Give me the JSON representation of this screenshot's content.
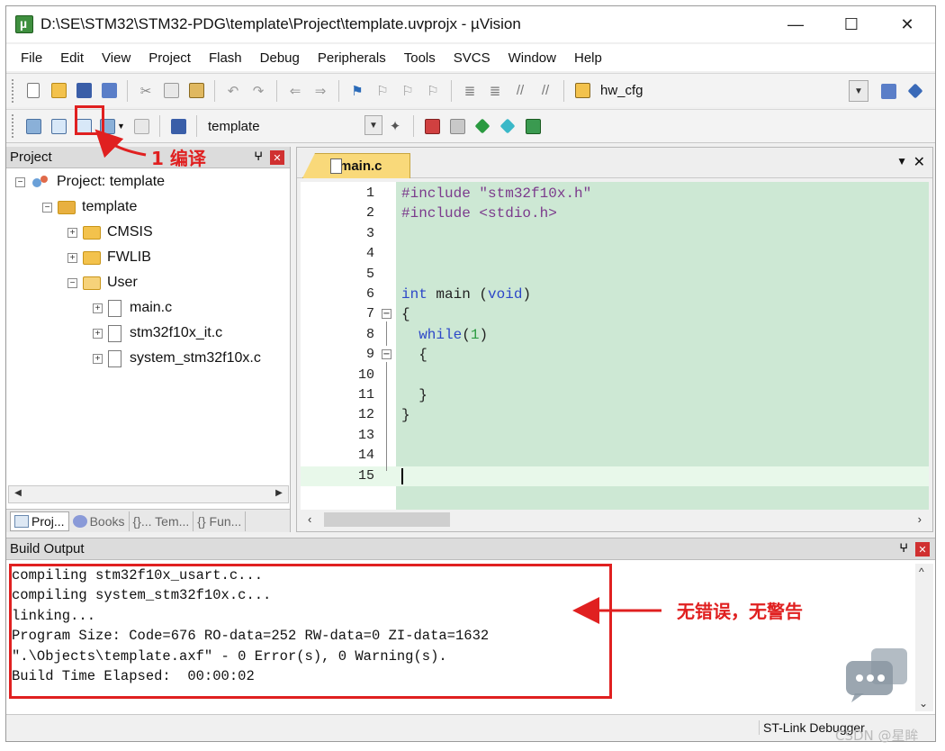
{
  "window": {
    "title": "D:\\SE\\STM32\\STM32-PDG\\template\\Project\\template.uvprojx - µVision",
    "minimize": "—",
    "maximize": "☐",
    "close": "✕"
  },
  "menu": [
    "File",
    "Edit",
    "View",
    "Project",
    "Flash",
    "Debug",
    "Peripherals",
    "Tools",
    "SVCS",
    "Window",
    "Help"
  ],
  "toolbar1": {
    "target_label": "hw_cfg"
  },
  "toolbar2": {
    "target_select": "template"
  },
  "project_panel": {
    "title": "Project",
    "pin": "ⵖ",
    "close": "✕",
    "tree": {
      "root": "Project: template",
      "target": "template",
      "groups": [
        "CMSIS",
        "FWLIB",
        "User"
      ],
      "files": [
        "main.c",
        "stm32f10x_it.c",
        "system_stm32f10x.c"
      ]
    },
    "tabs": [
      "Proj...",
      "Books",
      "{}... Tem...",
      "{} Fun..."
    ]
  },
  "editor": {
    "tab": "main.c",
    "lines": [
      {
        "n": "1",
        "parts": [
          {
            "t": "#include ",
            "c": "pp"
          },
          {
            "t": "\"stm32f10x.h\"",
            "c": "str"
          }
        ]
      },
      {
        "n": "2",
        "parts": [
          {
            "t": "#include ",
            "c": "pp"
          },
          {
            "t": "<stdio.h>",
            "c": "str"
          }
        ]
      },
      {
        "n": "3",
        "parts": []
      },
      {
        "n": "4",
        "parts": []
      },
      {
        "n": "5",
        "parts": []
      },
      {
        "n": "6",
        "parts": [
          {
            "t": "int",
            "c": "kw"
          },
          {
            "t": " main ",
            "c": "txt"
          },
          {
            "t": "(",
            "c": "txt"
          },
          {
            "t": "void",
            "c": "kw"
          },
          {
            "t": ")",
            "c": "txt"
          }
        ]
      },
      {
        "n": "7",
        "parts": [
          {
            "t": "{",
            "c": "txt"
          }
        ]
      },
      {
        "n": "8",
        "parts": [
          {
            "t": "  ",
            "c": "txt"
          },
          {
            "t": "while",
            "c": "kw"
          },
          {
            "t": "(",
            "c": "txt"
          },
          {
            "t": "1",
            "c": "num"
          },
          {
            "t": ")",
            "c": "txt"
          }
        ]
      },
      {
        "n": "9",
        "parts": [
          {
            "t": "  {",
            "c": "txt"
          }
        ]
      },
      {
        "n": "10",
        "parts": []
      },
      {
        "n": "11",
        "parts": [
          {
            "t": "  }",
            "c": "txt"
          }
        ]
      },
      {
        "n": "12",
        "parts": [
          {
            "t": "}",
            "c": "txt"
          }
        ]
      },
      {
        "n": "13",
        "parts": []
      },
      {
        "n": "14",
        "parts": []
      },
      {
        "n": "15",
        "parts": []
      }
    ]
  },
  "build_output": {
    "title": "Build Output",
    "lines": [
      "compiling stm32f10x_usart.c...",
      "compiling system_stm32f10x.c...",
      "linking...",
      "Program Size: Code=676 RO-data=252 RW-data=0 ZI-data=1632",
      "\".\\Objects\\template.axf\" - 0 Error(s), 0 Warning(s).",
      "Build Time Elapsed:  00:00:02"
    ]
  },
  "status": {
    "debugger": "ST-Link Debugger"
  },
  "annotations": {
    "compile": "1 编译",
    "no_errors": "无错误，无警告"
  },
  "watermark": "CSDN @星眸",
  "colors": {
    "annotation_red": "#e02020",
    "code_bg": "#cde8d4",
    "tab_active": "#f9d97a"
  }
}
